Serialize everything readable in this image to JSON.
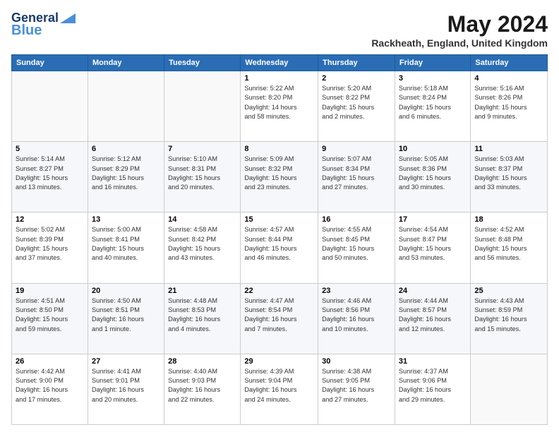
{
  "logo": {
    "line1": "General",
    "line2": "Blue"
  },
  "title": "May 2024",
  "location": "Rackheath, England, United Kingdom",
  "days_of_week": [
    "Sunday",
    "Monday",
    "Tuesday",
    "Wednesday",
    "Thursday",
    "Friday",
    "Saturday"
  ],
  "weeks": [
    [
      {
        "day": "",
        "info": ""
      },
      {
        "day": "",
        "info": ""
      },
      {
        "day": "",
        "info": ""
      },
      {
        "day": "1",
        "info": "Sunrise: 5:22 AM\nSunset: 8:20 PM\nDaylight: 14 hours\nand 58 minutes."
      },
      {
        "day": "2",
        "info": "Sunrise: 5:20 AM\nSunset: 8:22 PM\nDaylight: 15 hours\nand 2 minutes."
      },
      {
        "day": "3",
        "info": "Sunrise: 5:18 AM\nSunset: 8:24 PM\nDaylight: 15 hours\nand 6 minutes."
      },
      {
        "day": "4",
        "info": "Sunrise: 5:16 AM\nSunset: 8:26 PM\nDaylight: 15 hours\nand 9 minutes."
      }
    ],
    [
      {
        "day": "5",
        "info": "Sunrise: 5:14 AM\nSunset: 8:27 PM\nDaylight: 15 hours\nand 13 minutes."
      },
      {
        "day": "6",
        "info": "Sunrise: 5:12 AM\nSunset: 8:29 PM\nDaylight: 15 hours\nand 16 minutes."
      },
      {
        "day": "7",
        "info": "Sunrise: 5:10 AM\nSunset: 8:31 PM\nDaylight: 15 hours\nand 20 minutes."
      },
      {
        "day": "8",
        "info": "Sunrise: 5:09 AM\nSunset: 8:32 PM\nDaylight: 15 hours\nand 23 minutes."
      },
      {
        "day": "9",
        "info": "Sunrise: 5:07 AM\nSunset: 8:34 PM\nDaylight: 15 hours\nand 27 minutes."
      },
      {
        "day": "10",
        "info": "Sunrise: 5:05 AM\nSunset: 8:36 PM\nDaylight: 15 hours\nand 30 minutes."
      },
      {
        "day": "11",
        "info": "Sunrise: 5:03 AM\nSunset: 8:37 PM\nDaylight: 15 hours\nand 33 minutes."
      }
    ],
    [
      {
        "day": "12",
        "info": "Sunrise: 5:02 AM\nSunset: 8:39 PM\nDaylight: 15 hours\nand 37 minutes."
      },
      {
        "day": "13",
        "info": "Sunrise: 5:00 AM\nSunset: 8:41 PM\nDaylight: 15 hours\nand 40 minutes."
      },
      {
        "day": "14",
        "info": "Sunrise: 4:58 AM\nSunset: 8:42 PM\nDaylight: 15 hours\nand 43 minutes."
      },
      {
        "day": "15",
        "info": "Sunrise: 4:57 AM\nSunset: 8:44 PM\nDaylight: 15 hours\nand 46 minutes."
      },
      {
        "day": "16",
        "info": "Sunrise: 4:55 AM\nSunset: 8:45 PM\nDaylight: 15 hours\nand 50 minutes."
      },
      {
        "day": "17",
        "info": "Sunrise: 4:54 AM\nSunset: 8:47 PM\nDaylight: 15 hours\nand 53 minutes."
      },
      {
        "day": "18",
        "info": "Sunrise: 4:52 AM\nSunset: 8:48 PM\nDaylight: 15 hours\nand 56 minutes."
      }
    ],
    [
      {
        "day": "19",
        "info": "Sunrise: 4:51 AM\nSunset: 8:50 PM\nDaylight: 15 hours\nand 59 minutes."
      },
      {
        "day": "20",
        "info": "Sunrise: 4:50 AM\nSunset: 8:51 PM\nDaylight: 16 hours\nand 1 minute."
      },
      {
        "day": "21",
        "info": "Sunrise: 4:48 AM\nSunset: 8:53 PM\nDaylight: 16 hours\nand 4 minutes."
      },
      {
        "day": "22",
        "info": "Sunrise: 4:47 AM\nSunset: 8:54 PM\nDaylight: 16 hours\nand 7 minutes."
      },
      {
        "day": "23",
        "info": "Sunrise: 4:46 AM\nSunset: 8:56 PM\nDaylight: 16 hours\nand 10 minutes."
      },
      {
        "day": "24",
        "info": "Sunrise: 4:44 AM\nSunset: 8:57 PM\nDaylight: 16 hours\nand 12 minutes."
      },
      {
        "day": "25",
        "info": "Sunrise: 4:43 AM\nSunset: 8:59 PM\nDaylight: 16 hours\nand 15 minutes."
      }
    ],
    [
      {
        "day": "26",
        "info": "Sunrise: 4:42 AM\nSunset: 9:00 PM\nDaylight: 16 hours\nand 17 minutes."
      },
      {
        "day": "27",
        "info": "Sunrise: 4:41 AM\nSunset: 9:01 PM\nDaylight: 16 hours\nand 20 minutes."
      },
      {
        "day": "28",
        "info": "Sunrise: 4:40 AM\nSunset: 9:03 PM\nDaylight: 16 hours\nand 22 minutes."
      },
      {
        "day": "29",
        "info": "Sunrise: 4:39 AM\nSunset: 9:04 PM\nDaylight: 16 hours\nand 24 minutes."
      },
      {
        "day": "30",
        "info": "Sunrise: 4:38 AM\nSunset: 9:05 PM\nDaylight: 16 hours\nand 27 minutes."
      },
      {
        "day": "31",
        "info": "Sunrise: 4:37 AM\nSunset: 9:06 PM\nDaylight: 16 hours\nand 29 minutes."
      },
      {
        "day": "",
        "info": ""
      }
    ]
  ]
}
